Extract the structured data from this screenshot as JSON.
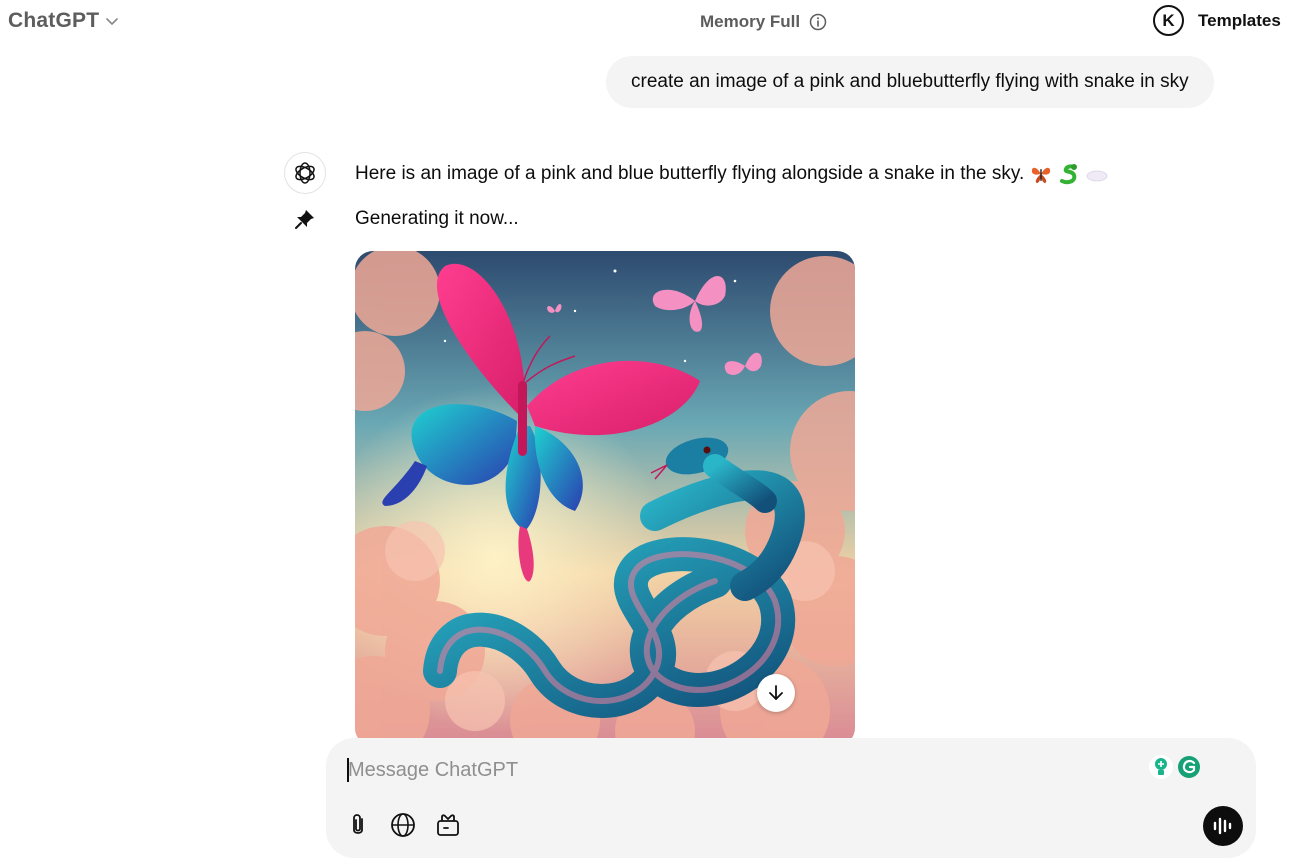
{
  "header": {
    "app_title": "ChatGPT",
    "model_menu_icon": "chevron-down-icon",
    "memory_label": "Memory Full",
    "memory_icon": "info-icon",
    "avatar_letter": "K",
    "templates_label": "Templates"
  },
  "conversation": {
    "user_message": "create an image of a pink and bluebutterfly flying with snake in sky",
    "assistant_message": "Here is an image of a pink and blue butterfly flying alongside a snake in the sky.",
    "assistant_emojis": [
      "butterfly-emoji",
      "snake-emoji",
      "cloud-emoji"
    ],
    "status_text": "Generating it now...",
    "image_icon": "download-icon"
  },
  "composer": {
    "placeholder": "Message ChatGPT",
    "value": "",
    "tools": [
      "attach-icon",
      "globe-icon",
      "tools-icon"
    ],
    "voice_icon": "voice-mode-icon"
  },
  "colors": {
    "bubble_bg": "#f4f4f4",
    "text": "#0d0d0d",
    "muted": "#5d5d5d",
    "voice_button": "#0d0d0d"
  }
}
